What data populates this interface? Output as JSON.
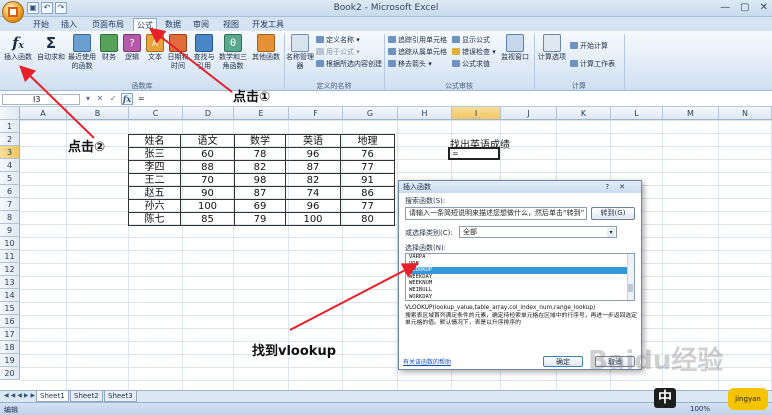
{
  "window": {
    "title": "Book2 - Microsoft Excel",
    "minimize": "—",
    "restore": "▢",
    "close": "✕"
  },
  "qat": [
    "▣",
    "↶",
    "↷"
  ],
  "tabs": [
    "开始",
    "插入",
    "页面布局",
    "公式",
    "数据",
    "审阅",
    "视图",
    "开发工具"
  ],
  "ribbon": {
    "insert_function": "插入函数",
    "autosum": "自动求和",
    "recent": "最近使用的函数",
    "financial": "财务",
    "logical": "逻辑",
    "text": "文本",
    "datetime": "日期和时间",
    "lookup": "查找与引用",
    "math": "数学和三角函数",
    "other": "其他函数",
    "group_library": "函数库",
    "name_manager": "名称管理器",
    "define_name": "定义名称",
    "use_in_formula": "用于公式",
    "create_from_sel": "根据所选内容创建",
    "group_names": "定义的名称",
    "trace_precedents": "追踪引用单元格",
    "trace_dependents": "追踪从属单元格",
    "remove_arrows": "移去箭头",
    "show_formulas": "显示公式",
    "error_check": "错误检查",
    "eval_formula": "公式求值",
    "watch": "监视窗口",
    "group_audit": "公式审核",
    "calc_options": "计算选项",
    "calc_now": "开始计算",
    "calc_sheet": "计算工作表",
    "group_calc": "计算"
  },
  "formula_bar": {
    "name_box": "I3",
    "buttons": "▾ ✕ ✓",
    "fx": "fx",
    "content": "="
  },
  "columns": [
    "A",
    "B",
    "C",
    "D",
    "E",
    "F",
    "G",
    "H",
    "I",
    "J",
    "K",
    "L",
    "M",
    "N"
  ],
  "rows": [
    "1",
    "2",
    "3",
    "4",
    "5",
    "6",
    "7",
    "8",
    "9",
    "10",
    "11",
    "12",
    "13",
    "14",
    "15",
    "16",
    "17",
    "18",
    "19",
    "20"
  ],
  "table": {
    "header": [
      "姓名",
      "语文",
      "数学",
      "英语",
      "地理"
    ],
    "rows": [
      [
        "张三",
        "60",
        "78",
        "96",
        "76"
      ],
      [
        "李四",
        "88",
        "82",
        "87",
        "77"
      ],
      [
        "王二",
        "70",
        "98",
        "82",
        "91"
      ],
      [
        "赵五",
        "90",
        "87",
        "74",
        "86"
      ],
      [
        "孙六",
        "100",
        "69",
        "96",
        "77"
      ],
      [
        "陈七",
        "85",
        "79",
        "100",
        "80"
      ]
    ]
  },
  "cells": {
    "i2": "找出英语成绩",
    "i3": "="
  },
  "dialog": {
    "title": "插入函数",
    "help": "?",
    "close": "✕",
    "search_label": "搜索函数(S):",
    "search_value": "请输入一条简短说明来描述您想做什么，然后单击“转到”",
    "go_button": "转到(G)",
    "category_label": "或选择类别(C):",
    "category_value": "全部",
    "select_label": "选择函数(N):",
    "functions": [
      "VARPA",
      "VDB",
      "VLOOKUP",
      "WEEKDAY",
      "WEEKNUM",
      "WEIBULL",
      "WORKDAY"
    ],
    "syntax": "VLOOKUP(lookup_value,table_array,col_index_num,range_lookup)",
    "description": "搜索表区域首列满足条件的元素，确定待检索单元格在区域中的行序号，再进一步返回选定单元格的值。默认情况下，表是以升序排序的",
    "help_link": "有关该函数的帮助",
    "ok": "确定",
    "cancel": "取消"
  },
  "sheets": {
    "nav": "◀◀◀▶▶▶",
    "tabs": [
      "Sheet1",
      "Sheet2",
      "Sheet3"
    ]
  },
  "status": {
    "mode": "编辑",
    "zoom": "100%"
  },
  "annotations": {
    "step1": "点击①",
    "step2": "点击②",
    "step3": "找到vlookup"
  },
  "watermark": {
    "text": "Baidu经验",
    "logo": "中",
    "badge": "jingyan"
  },
  "colors": {
    "arrow": "#e8202a",
    "accent": "#2b579a",
    "selected_item": "#3399d6"
  }
}
